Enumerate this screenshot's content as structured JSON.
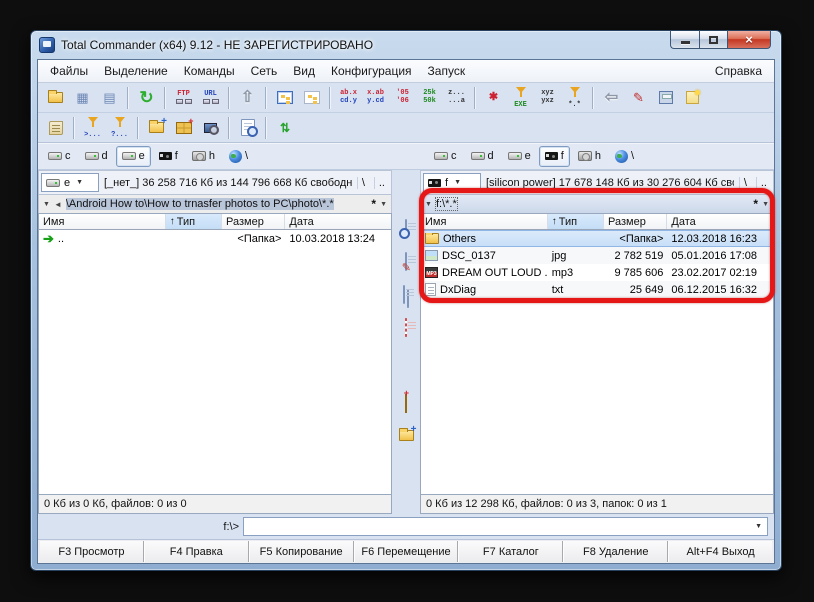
{
  "window": {
    "title": "Total Commander (x64) 9.12 - НЕ ЗАРЕГИСТРИРОВАНО"
  },
  "menu": {
    "items": [
      "Файлы",
      "Выделение",
      "Команды",
      "Сеть",
      "Вид",
      "Конфигурация",
      "Запуск"
    ],
    "help": "Справка"
  },
  "icons": {
    "refresh": "↻",
    "parent_dir": "⇧",
    "back": "⇦",
    "brief_view": "▦",
    "detail_view": "▤",
    "brush": "✎",
    "sync": "⇅",
    "resort": "✱",
    "combo_arrow": "▼",
    "path_menu": "▼",
    "path_back": "◄",
    "sort_asc": "↑",
    "updir_arrow": "➔",
    "dropdown": "▼"
  },
  "toolbar1": {
    "ftp": "FTP",
    "url": "URL",
    "sort_name": [
      "ab.x",
      "cd.y"
    ],
    "sort_ext": [
      "x.ab",
      "y.cd"
    ],
    "sort_date": [
      "'05",
      "'06"
    ],
    "sort_size": [
      "25k",
      "50k"
    ],
    "sort_rev": [
      "z...",
      "...a"
    ],
    "sort_xyz": [
      "xyz",
      "yxz"
    ],
    "exe": "EXE",
    "all": "*.*"
  },
  "toolbar2": {
    "sel": ">...",
    "unsel": "?..."
  },
  "drives": {
    "letters": [
      "c",
      "d",
      "e",
      "f",
      "h",
      "\\"
    ]
  },
  "left": {
    "drive": "e",
    "free": "[_нет_]  36 258 716 Кб из 144 796 668 Кб свободн",
    "root": "\\",
    "up": "..",
    "path": "\\Android How to\\How to trnasfer photos to PC\\photo\\*.*",
    "star": "*",
    "columns": {
      "name": "Имя",
      "type": "Тип",
      "size": "Размер",
      "date": "Дата"
    },
    "rows": [
      {
        "name": "..",
        "type": "",
        "size": "<Папка>",
        "date": "10.03.2018 13:24"
      }
    ],
    "status": "0 Кб из 0 Кб, файлов: 0 из 0"
  },
  "right": {
    "drive": "f",
    "free": "[silicon power]  17 678 148 Кб из 30 276 604 Кб сво",
    "root": "\\",
    "up": "..",
    "path": "f:\\*.*",
    "star": "*",
    "columns": {
      "name": "Имя",
      "type": "Тип",
      "size": "Размер",
      "date": "Дата"
    },
    "rows": [
      {
        "name": "Others",
        "type": "",
        "size": "<Папка>",
        "date": "12.03.2018 16:23"
      },
      {
        "name": "DSC_0137",
        "type": "jpg",
        "size": "2 782 519",
        "date": "05.01.2016 17:08"
      },
      {
        "name": "DREAM OUT LOUD ..",
        "type": "mp3",
        "size": "9 785 606",
        "date": "23.02.2017 02:19"
      },
      {
        "name": "DxDiag",
        "type": "txt",
        "size": "25 649",
        "date": "06.12.2015 16:32"
      }
    ],
    "status": "0 Кб из 12 298 Кб, файлов: 0 из 3, папок: 0 из 1"
  },
  "cmdline": {
    "label": "f:\\>"
  },
  "fkeys": [
    "F3 Просмотр",
    "F4 Правка",
    "F5 Копирование",
    "F6 Перемещение",
    "F7 Каталог",
    "F8 Удаление",
    "Alt+F4 Выход"
  ],
  "highlight_style": "border-color:#e51717"
}
